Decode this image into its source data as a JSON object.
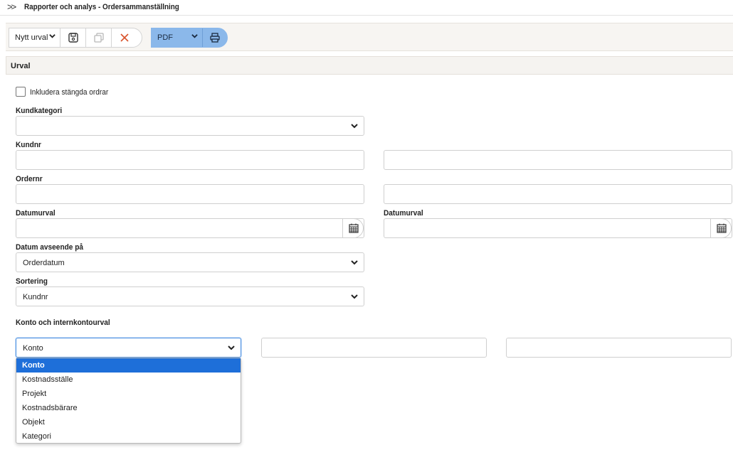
{
  "header": {
    "title": "Rapporter och analys - Ordersammanställning",
    "chevron_icon": "double-chevron-right-icon"
  },
  "toolbar": {
    "selection_value": "Nytt urval",
    "save_icon": "save-icon",
    "copy_icon": "copy-icon",
    "delete_icon": "close-icon",
    "output_value": "PDF",
    "print_icon": "print-icon"
  },
  "section": {
    "title": "Urval"
  },
  "form": {
    "include_closed_label": "Inkludera stängda ordrar",
    "include_closed_checked": false,
    "kundkategori_label": "Kundkategori",
    "kundkategori_value": "",
    "kundnr_label": "Kundnr",
    "ordernr_label": "Ordernr",
    "datumurval_from_label": "Datumurval",
    "datumurval_to_label": "Datumurval",
    "datum_avseende_label": "Datum avseende på",
    "datum_avseende_value": "Orderdatum",
    "sortering_label": "Sortering",
    "sortering_value": "Kundnr",
    "konto_section_label": "Konto och internkontourval",
    "konto_type_value": "Konto"
  },
  "dropdown": {
    "options": [
      "Konto",
      "Kostnadsställe",
      "Projekt",
      "Kostnadsbärare",
      "Objekt",
      "Kategori"
    ],
    "selected_index": 0
  },
  "colors": {
    "accent": "#8bb8ea",
    "selected_option": "#1e6fd9",
    "delete": "#d9532c"
  }
}
